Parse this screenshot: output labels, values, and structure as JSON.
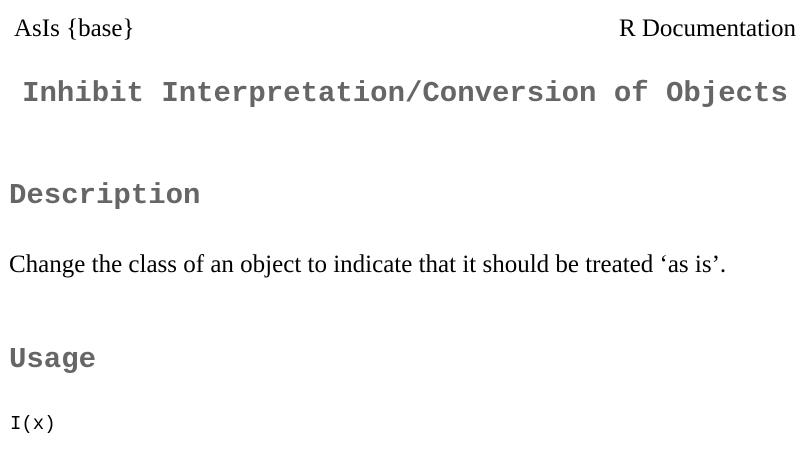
{
  "header": {
    "topic": "AsIs {base}",
    "source": "R Documentation"
  },
  "title": "Inhibit Interpretation/Conversion of Objects",
  "sections": {
    "description": {
      "heading": "Description",
      "text": "Change the class of an object to indicate that it should be treated ‘as is’."
    },
    "usage": {
      "heading": "Usage",
      "code": "I(x)"
    }
  }
}
